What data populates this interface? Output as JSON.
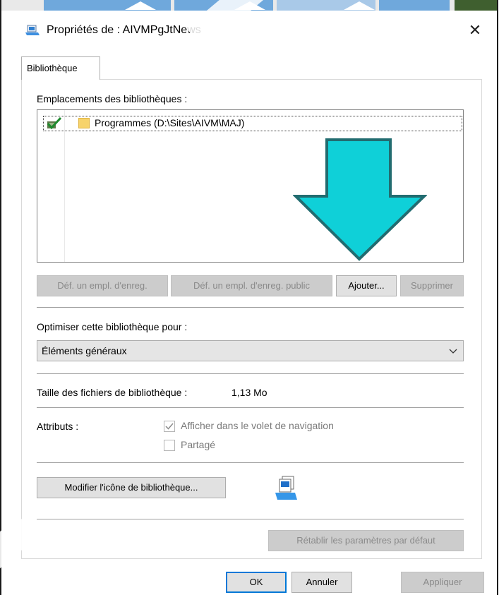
{
  "window": {
    "title": "Propriétés de : AIVMPgJtNews",
    "close_glyph": "✕"
  },
  "tabs": [
    {
      "label": "Bibliothèque",
      "active": true
    }
  ],
  "locations": {
    "label": "Emplacements des bibliothèques :",
    "items": [
      {
        "text": "Programmes (D:\\Sites\\AIVM\\MAJ)",
        "icon": "default-save-check-icon",
        "folder_icon": "folder-icon"
      }
    ]
  },
  "location_buttons": {
    "set_save": "Déf. un empl. d'enreg.",
    "set_public_save": "Déf. un empl. d'enreg. public",
    "add": "Ajouter...",
    "remove": "Supprimer"
  },
  "optimize": {
    "label": "Optimiser cette bibliothèque pour :",
    "selected": "Éléments généraux"
  },
  "size": {
    "label": "Taille des fichiers de bibliothèque :",
    "value": "1,13 Mo"
  },
  "attributes": {
    "label": "Attributs :",
    "show_in_nav": {
      "label": "Afficher dans le volet de navigation",
      "checked": true,
      "enabled": false
    },
    "shared": {
      "label": "Partagé",
      "checked": false,
      "enabled": false
    }
  },
  "change_icon_button": "Modifier l'icône de bibliothèque...",
  "restore_defaults_button": "Rétablir les paramètres par défaut",
  "footer": {
    "ok": "OK",
    "cancel": "Annuler",
    "apply": "Appliquer"
  },
  "colors": {
    "annotation_arrow_fill": "#0fd0d8",
    "annotation_arrow_stroke": "#226c70",
    "accent_focus": "#0078d7"
  }
}
